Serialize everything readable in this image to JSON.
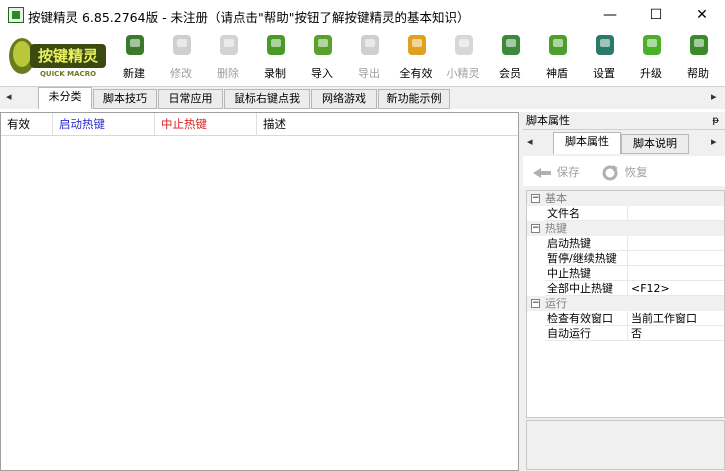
{
  "window": {
    "title": "按键精灵 6.85.2764版 - 未注册（请点击\"帮助\"按钮了解按键精灵的基本知识）",
    "minimize": "—",
    "maximize": "☐",
    "close": "✕"
  },
  "logo": {
    "text": "按键精灵",
    "subtext": "QUICK MACRO"
  },
  "toolbar": [
    {
      "label": "新建",
      "icon": "new-script-icon",
      "enabled": true
    },
    {
      "label": "修改",
      "icon": "edit-icon",
      "enabled": false
    },
    {
      "label": "删除",
      "icon": "trash-icon",
      "enabled": false
    },
    {
      "label": "录制",
      "icon": "record-camera-icon",
      "enabled": true
    },
    {
      "label": "导入",
      "icon": "import-icon",
      "enabled": true
    },
    {
      "label": "导出",
      "icon": "export-icon",
      "enabled": false
    },
    {
      "label": "全有效",
      "icon": "all-valid-icon",
      "enabled": true
    },
    {
      "label": "小精灵",
      "icon": "sprite-icon",
      "enabled": false
    },
    {
      "label": "会员",
      "icon": "member-icon",
      "enabled": true
    },
    {
      "label": "神盾",
      "icon": "shield-icon",
      "enabled": true
    },
    {
      "label": "设置",
      "icon": "settings-gear-icon",
      "enabled": true
    },
    {
      "label": "升级",
      "icon": "upgrade-icon",
      "enabled": true
    },
    {
      "label": "帮助",
      "icon": "help-icon",
      "enabled": true
    }
  ],
  "tabs": [
    {
      "label": "未分类",
      "active": true
    },
    {
      "label": "脚本技巧",
      "active": false
    },
    {
      "label": "日常应用",
      "active": false
    },
    {
      "label": "鼠标右键点我",
      "active": false
    },
    {
      "label": "网络游戏",
      "active": false
    },
    {
      "label": "新功能示例",
      "active": false
    }
  ],
  "list_columns": [
    {
      "label": "有效",
      "color": "#000000"
    },
    {
      "label": "启动热键",
      "color": "#2a2ad0"
    },
    {
      "label": "中止热键",
      "color": "#e02020"
    },
    {
      "label": "描述",
      "color": "#000000"
    }
  ],
  "right_panel": {
    "title": "脚本属性",
    "pin": "ᵽ",
    "tabs": [
      {
        "label": "脚本属性",
        "active": true
      },
      {
        "label": "脚本说明",
        "active": false
      }
    ],
    "save_label": "保存",
    "restore_label": "恢复",
    "categories": [
      {
        "name": "基本",
        "expander": "−",
        "items": [
          {
            "key": "文件名",
            "value": ""
          }
        ]
      },
      {
        "name": "热键",
        "expander": "−",
        "items": [
          {
            "key": "启动热键",
            "value": ""
          },
          {
            "key": "暂停/继续热键",
            "value": ""
          },
          {
            "key": "中止热键",
            "value": ""
          },
          {
            "key": "全部中止热键",
            "value": "<F12>"
          }
        ]
      },
      {
        "name": "运行",
        "expander": "−",
        "items": [
          {
            "key": "检查有效窗口",
            "value": "当前工作窗口"
          },
          {
            "key": "自动运行",
            "value": "否"
          }
        ]
      }
    ]
  },
  "arrows": {
    "left": "◂",
    "right": "▸"
  }
}
